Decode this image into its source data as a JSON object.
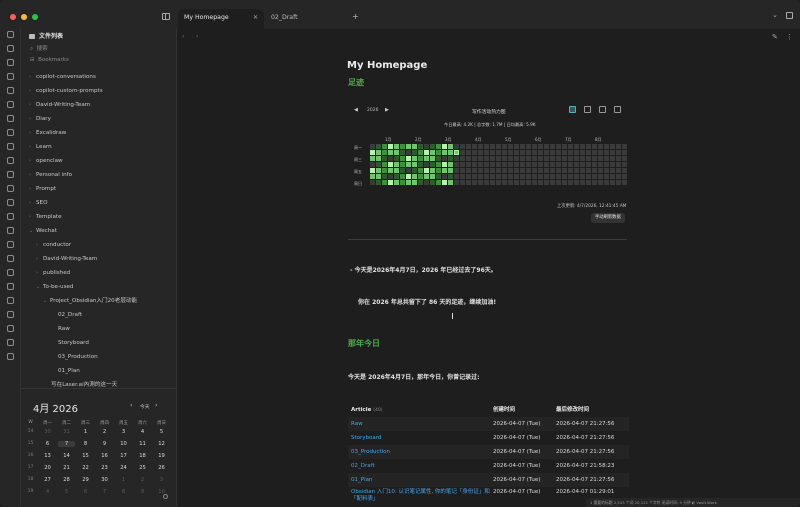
{
  "window": {
    "tabs": [
      {
        "label": "My Homepage",
        "active": true
      },
      {
        "label": "02_Draft",
        "active": false
      }
    ],
    "new_tab": "+",
    "more_menu": "⌄"
  },
  "sidebar": {
    "vault_title": "文件列表",
    "search_label": "搜索",
    "bookmarks_label": "Bookmarks",
    "tree": [
      {
        "label": "copilot-conversations",
        "depth": 0,
        "folder": true
      },
      {
        "label": "copilot-custom-prompts",
        "depth": 0,
        "folder": true
      },
      {
        "label": "David-Writing-Team",
        "depth": 0,
        "folder": true
      },
      {
        "label": "Diary",
        "depth": 0,
        "folder": true
      },
      {
        "label": "Excalidraw",
        "depth": 0,
        "folder": true
      },
      {
        "label": "Learn",
        "depth": 0,
        "folder": true
      },
      {
        "label": "openclaw",
        "depth": 0,
        "folder": true
      },
      {
        "label": "Personal info",
        "depth": 0,
        "folder": true
      },
      {
        "label": "Prompt",
        "depth": 0,
        "folder": true
      },
      {
        "label": "SEO",
        "depth": 0,
        "folder": true
      },
      {
        "label": "Template",
        "depth": 0,
        "folder": true
      },
      {
        "label": "Wechat",
        "depth": 0,
        "folder": true,
        "open": true
      },
      {
        "label": "conductor",
        "depth": 1,
        "folder": true
      },
      {
        "label": "David-Writing-Team",
        "depth": 1,
        "folder": true
      },
      {
        "label": "published",
        "depth": 1,
        "folder": true
      },
      {
        "label": "To-be-used",
        "depth": 1,
        "folder": true,
        "open": true
      },
      {
        "label": "Project_Obsidian入门20老层动能",
        "depth": 2,
        "folder": true,
        "open": true
      },
      {
        "label": "02_Draft",
        "depth": 3,
        "folder": false
      },
      {
        "label": "Raw",
        "depth": 3,
        "folder": false
      },
      {
        "label": "Storyboard",
        "depth": 3,
        "folder": false
      },
      {
        "label": "03_Production",
        "depth": 3,
        "folder": false
      },
      {
        "label": "01_Plan",
        "depth": 3,
        "folder": false
      },
      {
        "label": "写在Laser.ai內測的这一天",
        "depth": 2,
        "folder": false
      }
    ]
  },
  "calendar": {
    "month": "4月 2026",
    "prev": "‹",
    "today_label": "今天",
    "next": "›",
    "week_header": [
      "W",
      "周一",
      "周二",
      "周三",
      "周四",
      "周五",
      "周六",
      "周日"
    ],
    "rows": [
      [
        "14",
        "30",
        "31",
        "1",
        "2",
        "3",
        "4",
        "5"
      ],
      [
        "15",
        "6",
        "7",
        "8",
        "9",
        "10",
        "11",
        "12"
      ],
      [
        "16",
        "13",
        "14",
        "15",
        "16",
        "17",
        "18",
        "19"
      ],
      [
        "17",
        "20",
        "21",
        "22",
        "23",
        "24",
        "25",
        "26"
      ],
      [
        "18",
        "27",
        "28",
        "29",
        "30",
        "1",
        "2",
        "3"
      ],
      [
        "19",
        "4",
        "5",
        "6",
        "7",
        "8",
        "9",
        "10"
      ]
    ],
    "today": "7"
  },
  "note": {
    "title": "My Homepage",
    "section1": "足迹",
    "heatmap": {
      "year": "2026",
      "prev": "◀",
      "next": "▶",
      "title": "写作活动热力图",
      "stats": "今日最高: 4.2K | 总字数: 1.7M | 日均最高: 5.9K",
      "months": [
        "1月",
        "2月",
        "3月",
        "4月",
        "5月",
        "6月",
        "7月",
        "8月"
      ],
      "weekdays": [
        "周一",
        "周三",
        "周五",
        "周日"
      ],
      "last_updated": "上次更新: 4/7/2026, 12:41:45 AM",
      "refresh_button": "手动刷新数据",
      "colors": {
        "empty": "#3a3a3a",
        "l1": "#2d5b2d",
        "l2": "#3f8f3f",
        "l3": "#6fc46f",
        "l4": "#b9f0b0"
      }
    },
    "line1": "- 今天是2026年4月7日，2026 年已经过去了96天。",
    "line2": "你在 2026 年总共留下了 86 天的足迹，继续加油!",
    "section2": "那年今日",
    "line3": "今天是 2026年4月7日，那年今日，你曾记录过:",
    "table": {
      "headers": [
        "Article",
        "创建时间",
        "最后修改时间"
      ],
      "count": "(40)",
      "rows": [
        [
          "Raw",
          "2026-04-07 (Tue)",
          "2026-04-07 21:27:56"
        ],
        [
          "Storyboard",
          "2026-04-07 (Tue)",
          "2026-04-07 21:27:56"
        ],
        [
          "03_Production",
          "2026-04-07 (Tue)",
          "2026-04-07 21:27:56"
        ],
        [
          "02_Draft",
          "2026-04-07 (Tue)",
          "2026-04-07 21:58:23"
        ],
        [
          "01_Plan",
          "2026-04-07 (Tue)",
          "2026-04-07 21:27:56"
        ],
        [
          "Obsidian 入门10: 认识笔记属性, 你的笔记「身份证」和「配料表」",
          "2026-04-07 (Tue)",
          "2026-04-07 01:29:01"
        ]
      ]
    }
  },
  "statusbar": "1 重要的标题  2,543 个词  20,122 个字符  阅读时间: 9 分钟  ◐ Vault.Work"
}
